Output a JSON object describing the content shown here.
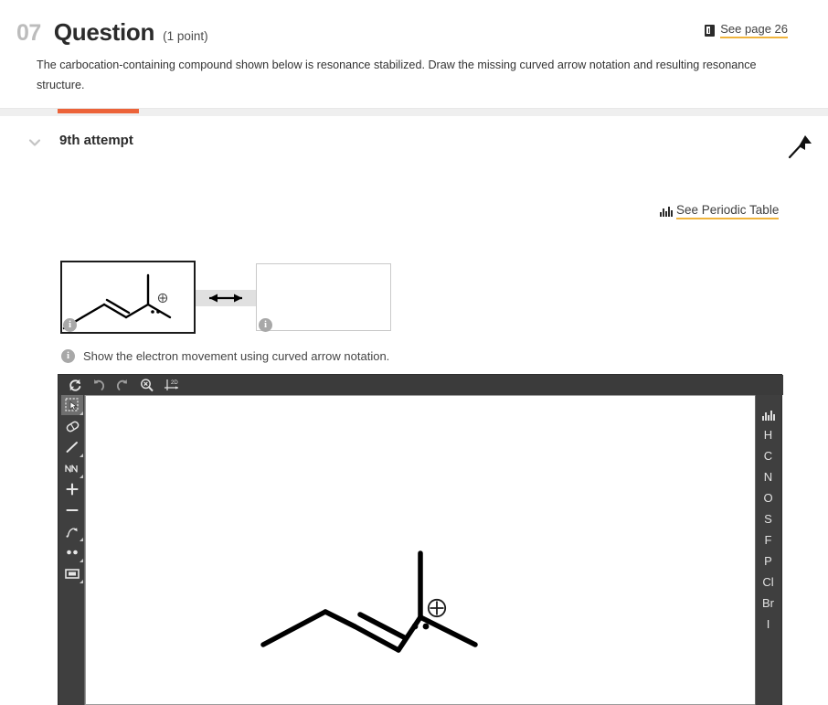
{
  "header": {
    "question_number": "07",
    "title": "Question",
    "points": "(1 point)",
    "body": "The carbocation-containing compound shown below is resonance stabilized. Draw the missing curved arrow notation and resulting resonance structure.",
    "see_page_label": "See page 26",
    "see_page_icon": "book-icon"
  },
  "attempt": {
    "label": "9th attempt",
    "chevron_icon": "chevron-down-icon",
    "flag_icon": "flag-pointer-icon",
    "indicator_color": "#ec6339"
  },
  "periodic_link": {
    "label": "See Periodic Table",
    "icon": "periodic-table-icon",
    "underline_color": "#f0b43c"
  },
  "resonance": {
    "arrow_icon": "double-headed-resonance-arrow",
    "box_a_info_icon": "info-icon",
    "box_b_info_icon": "info-icon",
    "hint_icon": "info-icon",
    "hint_text": "Show the electron movement using curved arrow notation."
  },
  "editor": {
    "toolbar": [
      {
        "name": "reset-icon",
        "label": "reset"
      },
      {
        "name": "undo-icon",
        "label": "undo"
      },
      {
        "name": "redo-icon",
        "label": "redo"
      },
      {
        "name": "zoom-reset-icon",
        "label": "zoom"
      },
      {
        "name": "clean-2d-icon",
        "label": "2D"
      }
    ],
    "tools": [
      {
        "name": "select-tool",
        "label": "select",
        "active": true
      },
      {
        "name": "eraser-tool",
        "label": "eraser",
        "active": false
      },
      {
        "name": "single-bond-tool",
        "label": "single bond",
        "active": false
      },
      {
        "name": "chain-tool",
        "label": "chain",
        "active": false
      },
      {
        "name": "plus-charge-tool",
        "label": "plus charge",
        "active": false
      },
      {
        "name": "minus-charge-tool",
        "label": "minus charge",
        "active": false
      },
      {
        "name": "curved-arrow-tool",
        "label": "curved arrow",
        "active": false
      },
      {
        "name": "lone-pair-tool",
        "label": "lone pair",
        "active": false
      },
      {
        "name": "rectangle-tool",
        "label": "rectangle",
        "active": false
      }
    ],
    "elements": [
      "H",
      "C",
      "N",
      "O",
      "S",
      "F",
      "P",
      "Cl",
      "Br",
      "I"
    ],
    "element_panel_icon": "periodic-table-icon",
    "molecule": {
      "charge_symbol": "⊕",
      "lone_pair": "••",
      "description": "pent-2-ene cation with vertical methyl bond, plus charge and lone pair at C4"
    }
  }
}
